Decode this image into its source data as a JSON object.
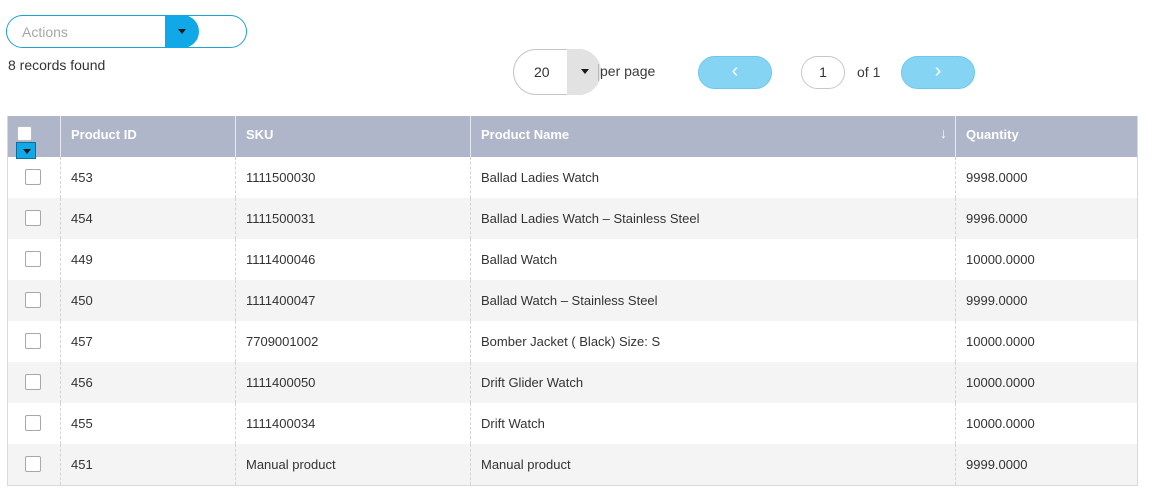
{
  "actions": {
    "placeholder": "Actions"
  },
  "records_found": "8 records found",
  "pagination": {
    "per_page_value": "20",
    "per_page_label": "per page",
    "prev_symbol": "‹",
    "next_symbol": "›",
    "current_page": "1",
    "of_label": "of 1"
  },
  "table": {
    "columns": [
      "Product ID",
      "SKU",
      "Product Name",
      "Quantity"
    ],
    "sort_column": "Product Name",
    "sort_symbol": "↓",
    "rows": [
      {
        "id": "453",
        "sku": "1111500030",
        "name": "Ballad Ladies Watch",
        "qty": "9998.0000"
      },
      {
        "id": "454",
        "sku": "1111500031",
        "name": "Ballad Ladies Watch – Stainless Steel",
        "qty": "9996.0000"
      },
      {
        "id": "449",
        "sku": "1111400046",
        "name": "Ballad Watch",
        "qty": "10000.0000"
      },
      {
        "id": "450",
        "sku": "1111400047",
        "name": "Ballad Watch – Stainless Steel",
        "qty": "9999.0000"
      },
      {
        "id": "457",
        "sku": "7709001002",
        "name": "Bomber Jacket ( Black) Size: S",
        "qty": "10000.0000"
      },
      {
        "id": "456",
        "sku": "1111400050",
        "name": "Drift Glider Watch",
        "qty": "10000.0000"
      },
      {
        "id": "455",
        "sku": "1111400034",
        "name": "Drift Watch",
        "qty": "10000.0000"
      },
      {
        "id": "451",
        "sku": "Manual product",
        "name": "Manual product",
        "qty": "9999.0000"
      }
    ]
  }
}
